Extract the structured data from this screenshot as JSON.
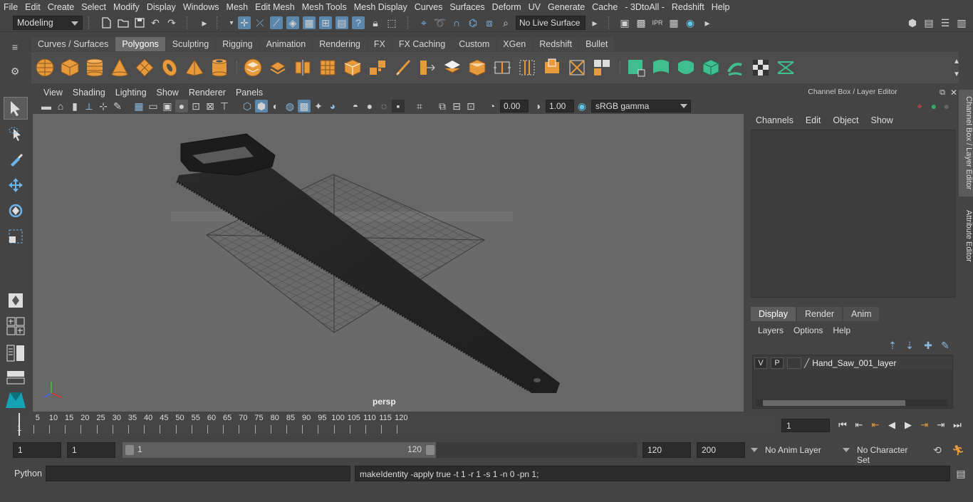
{
  "menubar": {
    "items": [
      "File",
      "Edit",
      "Create",
      "Select",
      "Modify",
      "Display",
      "Windows",
      "Mesh",
      "Edit Mesh",
      "Mesh Tools",
      "Mesh Display",
      "Curves",
      "Surfaces",
      "Deform",
      "UV",
      "Generate",
      "Cache",
      "- 3DtoAll -",
      "Redshift",
      "Help"
    ]
  },
  "statusline": {
    "mode": "Modeling",
    "live_surface": "No Live Surface"
  },
  "shelf": {
    "tabs": [
      "Curves / Surfaces",
      "Polygons",
      "Sculpting",
      "Rigging",
      "Animation",
      "Rendering",
      "FX",
      "FX Caching",
      "Custom",
      "XGen",
      "Redshift",
      "Bullet"
    ],
    "active_tab": "Polygons",
    "orange_color": "#e69a3c",
    "green_color": "#3fbf8f"
  },
  "viewport": {
    "menu": [
      "View",
      "Shading",
      "Lighting",
      "Show",
      "Renderer",
      "Panels"
    ],
    "exposure": "0.00",
    "gamma": "1.00",
    "color_space": "sRGB gamma",
    "camera": "persp"
  },
  "channel_box": {
    "title": "Channel Box / Layer Editor",
    "menu": [
      "Channels",
      "Edit",
      "Object",
      "Show"
    ]
  },
  "layer_editor": {
    "tabs": [
      "Display",
      "Render",
      "Anim"
    ],
    "active_tab": "Display",
    "menu": [
      "Layers",
      "Options",
      "Help"
    ],
    "layer": {
      "visible": "V",
      "playback": "P",
      "name": "Hand_Saw_001_layer"
    }
  },
  "side_tabs": {
    "channel_box": "Channel Box / Layer Editor",
    "attribute_editor": "Attribute Editor"
  },
  "timeline": {
    "ticks": [
      "5",
      "10",
      "15",
      "20",
      "25",
      "30",
      "35",
      "40",
      "45",
      "50",
      "55",
      "60",
      "65",
      "70",
      "75",
      "80",
      "85",
      "90",
      "95",
      "100",
      "105",
      "110",
      "115",
      "120"
    ],
    "current_frame_label": "1",
    "current_frame": "1"
  },
  "range": {
    "start": "1",
    "playback_start": "1",
    "range_start_label": "1",
    "range_end_label": "120",
    "playback_end": "120",
    "end": "200",
    "anim_layer": "No Anim Layer",
    "character_set": "No Character Set"
  },
  "command_line": {
    "language": "Python",
    "result": "makeIdentity -apply true -t 1 -r 1 -s 1 -n 0 -pn 1;"
  }
}
